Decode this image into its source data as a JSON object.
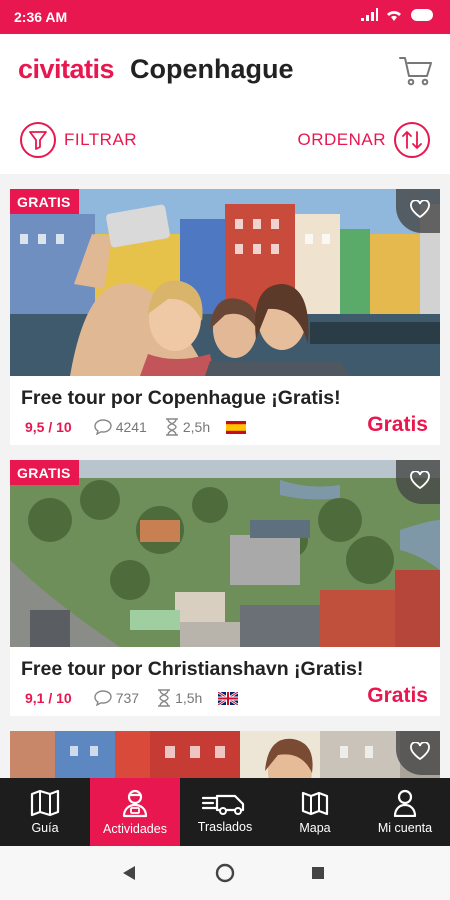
{
  "status_bar": {
    "time": "2:36 AM"
  },
  "header": {
    "brand": "civitatis",
    "city": "Copenhague"
  },
  "toolbar": {
    "filter_label": "FILTRAR",
    "sort_label": "ORDENAR"
  },
  "cards": [
    {
      "badge": "GRATIS",
      "title": "Free tour por Copenhague ¡Gratis!",
      "rating": "9,5 / 10",
      "reviews": "4241",
      "duration": "2,5h",
      "language_flag": "flag-spain-icon",
      "price": "Gratis"
    },
    {
      "badge": "GRATIS",
      "title": "Free tour por Christianshavn ¡Gratis!",
      "rating": "9,1 / 10",
      "reviews": "737",
      "duration": "1,5h",
      "language_flag": "flag-uk-icon",
      "price": "Gratis"
    }
  ],
  "bottom_nav": [
    {
      "label": "Guía",
      "icon": "map-book-icon",
      "active": false
    },
    {
      "label": "Actividades",
      "icon": "guide-person-icon",
      "active": true
    },
    {
      "label": "Traslados",
      "icon": "car-transfer-icon",
      "active": false
    },
    {
      "label": "Mapa",
      "icon": "map-icon",
      "active": false
    },
    {
      "label": "Mi cuenta",
      "icon": "user-icon",
      "active": false
    }
  ],
  "colors": {
    "accent": "#e8174f",
    "nav_bg": "#1d1d1d"
  }
}
